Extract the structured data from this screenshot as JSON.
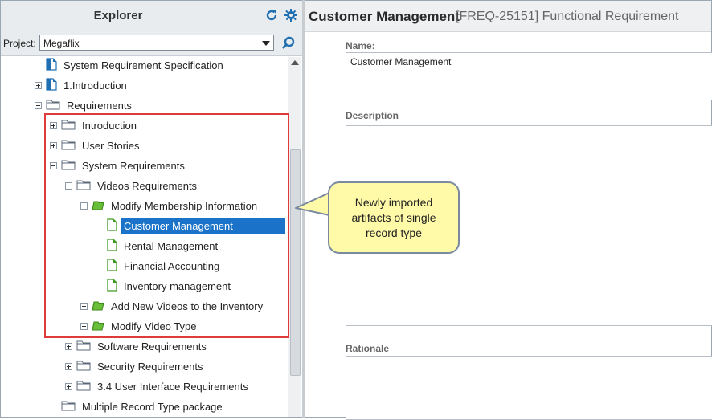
{
  "explorer": {
    "title": "Explorer",
    "project_label": "Project:",
    "project_value": "Megaflix"
  },
  "tree": [
    {
      "label": "System Requirement Specification",
      "icon": "document-icon",
      "toggle": "none",
      "depth": 0
    },
    {
      "label": "1.Introduction",
      "icon": "document-icon",
      "toggle": "plus",
      "depth": 0
    },
    {
      "label": "Requirements",
      "icon": "folder-icon",
      "toggle": "minus",
      "depth": 0
    },
    {
      "label": "Introduction",
      "icon": "folder-icon",
      "toggle": "plus",
      "depth": 1
    },
    {
      "label": "User Stories",
      "icon": "folder-icon",
      "toggle": "plus",
      "depth": 1
    },
    {
      "label": "System Requirements",
      "icon": "folder-icon",
      "toggle": "minus",
      "depth": 1
    },
    {
      "label": "Videos Requirements",
      "icon": "folder-icon",
      "toggle": "minus",
      "depth": 2
    },
    {
      "label": "Modify Membership Information",
      "icon": "green-folder-icon",
      "toggle": "minus",
      "depth": 3
    },
    {
      "label": "Customer Management",
      "icon": "green-document-icon",
      "toggle": "none",
      "depth": 4,
      "selected": true
    },
    {
      "label": "Rental Management",
      "icon": "green-document-icon",
      "toggle": "none",
      "depth": 4
    },
    {
      "label": "Financial Accounting",
      "icon": "green-document-icon",
      "toggle": "none",
      "depth": 4
    },
    {
      "label": "Inventory management",
      "icon": "green-document-icon",
      "toggle": "none",
      "depth": 4
    },
    {
      "label": "Add New Videos to the Inventory",
      "icon": "green-folder-icon",
      "toggle": "plus",
      "depth": 3
    },
    {
      "label": "Modify Video Type",
      "icon": "green-folder-icon",
      "toggle": "plus",
      "depth": 3
    },
    {
      "label": "Software Requirements",
      "icon": "folder-icon",
      "toggle": "plus",
      "depth": 2
    },
    {
      "label": "Security Requirements",
      "icon": "folder-icon",
      "toggle": "plus",
      "depth": 2
    },
    {
      "label": "3.4 User Interface Requirements",
      "icon": "folder-icon",
      "toggle": "plus",
      "depth": 2
    },
    {
      "label": "Multiple Record Type package",
      "icon": "folder-icon",
      "toggle": "none",
      "depth": 1
    }
  ],
  "detail": {
    "title": "Customer Management",
    "subtitle": "[FREQ-25151] Functional Requirement",
    "name_label": "Name:",
    "name_value": "Customer Management",
    "description_label": "Description",
    "rationale_label": "Rationale"
  },
  "callout": {
    "text": "Newly imported artifacts of single record type"
  },
  "colors": {
    "selection": "#1a73c8",
    "highlight_border": "#e03b3b",
    "callout_fill": "#fffaa8",
    "icon_blue": "#1f6fb2",
    "icon_green": "#6abf3a"
  }
}
